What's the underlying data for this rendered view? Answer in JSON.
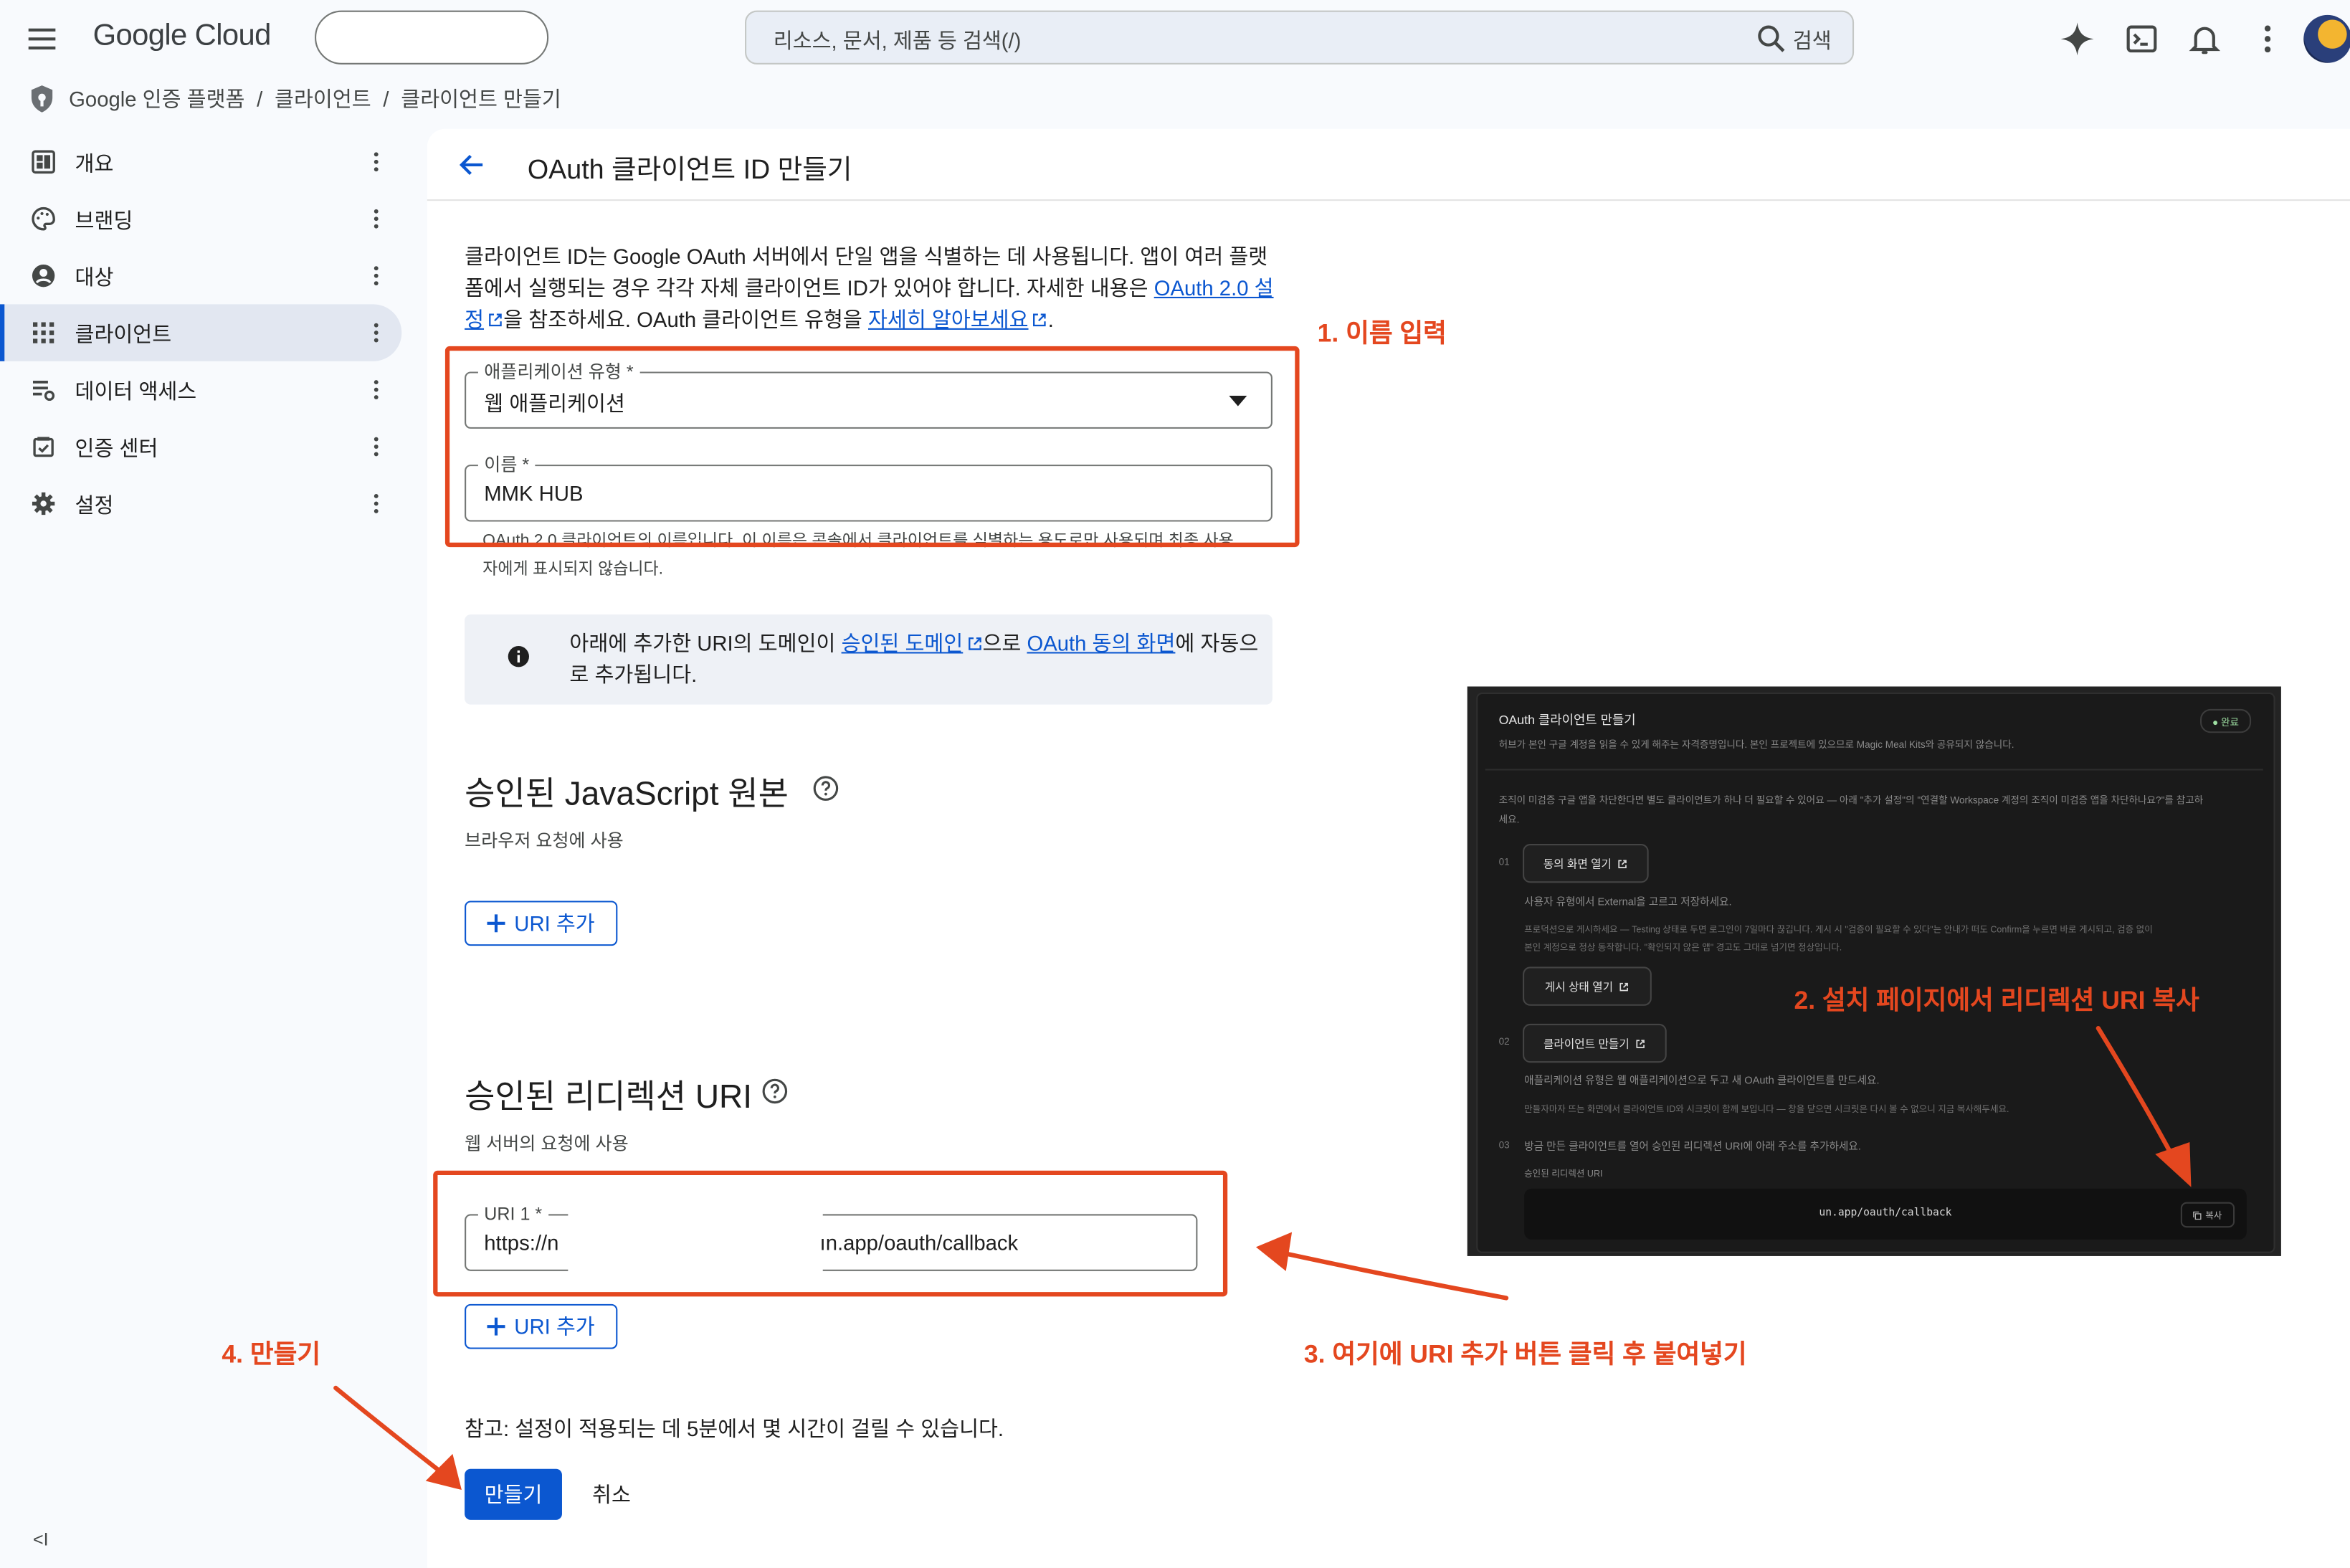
{
  "header": {
    "logo": "Google Cloud",
    "search_placeholder": "리소스, 문서, 제품 등 검색(/)",
    "search_button": "검색"
  },
  "breadcrumb": [
    "Google 인증 플랫폼",
    "클라이언트",
    "클라이언트 만들기"
  ],
  "breadcrumb_sep": "/",
  "sidebar": {
    "items": [
      {
        "label": "개요",
        "icon": "dashboard-icon"
      },
      {
        "label": "브랜딩",
        "icon": "palette-icon"
      },
      {
        "label": "대상",
        "icon": "account-circle-icon"
      },
      {
        "label": "클라이언트",
        "icon": "apps-grid-icon",
        "active": true
      },
      {
        "label": "데이터 액세스",
        "icon": "data-settings-icon"
      },
      {
        "label": "인증 센터",
        "icon": "verified-icon"
      },
      {
        "label": "설정",
        "icon": "gear-icon"
      }
    ],
    "collapse": "<I"
  },
  "form": {
    "title": "OAuth 클라이언트 ID 만들기",
    "intro_1": "클라이언트 ID는 Google OAuth 서버에서 단일 앱을 식별하는 데 사용됩니다. 앱이 여러 플랫폼에서 실행되는 경우 각각 자체 클라이언트 ID가 있어야 합니다. 자세한 내용은 ",
    "intro_link_1": "OAuth 2.0 설정",
    "intro_2": "을 참조하세요. OAuth 클라이언트 유형을 ",
    "intro_link_2": "자세히 알아보세요",
    "intro_3": ".",
    "app_type_label": "애플리케이션 유형 *",
    "app_type_value": "웹 애플리케이션",
    "name_label": "이름 *",
    "name_value": "MMK HUB",
    "name_hint": "OAuth 2.0 클라이언트의 이름입니다. 이 이름은 콘솔에서 클라이언트를 식별하는 용도로만 사용되며 최종 사용자에게 표시되지 않습니다.",
    "info_1": "아래에 추가한 URI의 도메인이 ",
    "info_link_1": "승인된 도메인",
    "info_2": "으로 ",
    "info_link_2": "OAuth 동의 화면",
    "info_3": "에 자동으로 추가됩니다.",
    "js_origin_title": "승인된 JavaScript 원본",
    "js_origin_sub": "브라우저 요청에 사용",
    "add_uri": "URI 추가",
    "redirect_title": "승인된 리디렉션 URI",
    "redirect_sub": "웹 서버의 요청에 사용",
    "uri1_label": "URI 1 *",
    "uri1_value_start": "https://n",
    "uri1_value_end": "ın.app/oauth/callback",
    "note": "참고: 설정이 적용되는 데 5분에서 몇 시간이 걸릴 수 있습니다.",
    "create": "만들기",
    "cancel": "취소"
  },
  "annotations": {
    "step1": "1. 이름 입력",
    "step2": "2. 설치 페이지에서 리디렉션 URI 복사",
    "step3": "3. 여기에 URI 추가 버튼 클릭 후 붙여넣기",
    "step4": "4. 만들기",
    "color": "#e4471f"
  },
  "inset": {
    "title": "OAuth 클라이언트 만들기",
    "subtitle": "허브가 본인 구글 계정을 읽을 수 있게 해주는 자격증명입니다. 본인 프로젝트에 있으므로 Magic Meal Kits와 공유되지 않습니다.",
    "status": "● 완료",
    "warning_1": "조직이 미검증 구글 앱을 차단한다면 별도 클라이언트가 하나 더 필요할 수 있어요 — 아래 \"추가 설정\"의 \"연결할 Workspace 계정의 조직이 미검증 앱을 차단하나요?\"를 참고하",
    "warning_2": "세요.",
    "step1_num": "01",
    "step1_button": "동의 화면 열기",
    "step1_desc": "사용자 유형에서 External을 고르고 저장하세요.",
    "step1_detail_1": "프로덕션으로 게시하세요 — Testing 상태로 두면 로그인이 7일마다 끊깁니다. 게시 시 \"검증이 필요할 수 있다\"는 안내가 떠도 Confirm을 누르면 바로 게시되고, 검증 없이",
    "step1_detail_2": "본인 계정으로 정상 동작합니다. \"확인되지 않은 앱\" 경고도 그대로 넘기면 정상입니다.",
    "publish_button": "게시 상태 열기",
    "step2_num": "02",
    "step2_button": "클라이언트 만들기",
    "step2_desc": "애플리케이션 유형은 웹 애플리케이션으로 두고 새 OAuth 클라이언트를 만드세요.",
    "step2_detail": "만들자마자 뜨는 화면에서 클라이언트 ID와 시크릿이 함께 보입니다 — 창을 닫으면 시크릿은 다시 볼 수 없으니 지금 복사해두세요.",
    "step3_num": "03",
    "step3_desc": "방금 만든 클라이언트를 열어 승인된 리디렉션 URI에 아래 주소를 추가하세요.",
    "uri_caption": "승인된  리디렉션  URI",
    "uri_value": "un.app/oauth/callback",
    "copy": "복사"
  }
}
